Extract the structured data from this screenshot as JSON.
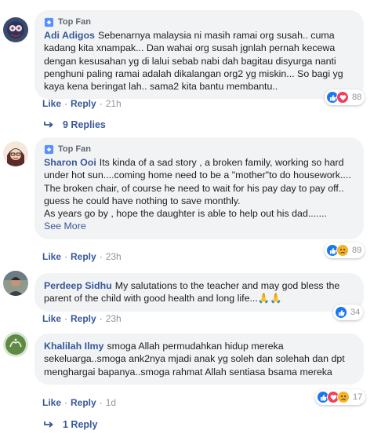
{
  "comments": [
    {
      "badge": "Top Fan",
      "author": "Adi Adigos",
      "text": "Sebenarnya malaysia ni masih ramai org susah.. cuma kadang kita xnampak... Dan wahai org susah jgnlah pernah kecewa dengan kesusahan yg di lalui sebab nabi dah bagitau disyurga nanti penghuni paling ramai adalah dikalangan org2 yg miskin... So bagi yg kaya kena beringat lah.. sama2 kita bantu membantu..",
      "like_label": "Like",
      "reply_label": "Reply",
      "time": "21h",
      "reaction_count": "88",
      "reactions": [
        "like-reaction-icon",
        "love-reaction-icon"
      ],
      "replies_label": "9 Replies"
    },
    {
      "badge": "Top Fan",
      "author": "Sharon Ooi",
      "text": "Its kinda of a sad story , a broken family, working so hard under hot sun....coming home need to be a \"mother\"to do housework....\nThe broken chair, of course he need to wait for his pay day to pay off.. guess he could have nothing to save monthly.\nAs years go by , hope the daughter is able to help out his dad.......",
      "see_more": "See More",
      "like_label": "Like",
      "reply_label": "Reply",
      "time": "23h",
      "reaction_count": "89",
      "reactions": [
        "like-reaction-icon",
        "sad-reaction-icon"
      ]
    },
    {
      "author": "Perdeep Sidhu",
      "text": "My salutations to the teacher and may god bless the parent of the child with good health and long life...🙏🙏",
      "like_label": "Like",
      "reply_label": "Reply",
      "time": "23h",
      "reaction_count": "34",
      "reactions": [
        "like-reaction-icon"
      ]
    },
    {
      "author": "Khalilah Ilmy",
      "text": "smoga Allah permudahkan hidup mereka sekeluarga..smoga ank2nya mjadi anak yg soleh dan solehah dan dpt menghargai bapanya..smoga rahmat Allah sentiasa bsama mereka",
      "like_label": "Like",
      "reply_label": "Reply",
      "time": "1d",
      "reaction_count": "17",
      "reactions": [
        "like-reaction-icon",
        "love-reaction-icon",
        "sad-reaction-icon"
      ],
      "replies_label": "1 Reply"
    }
  ],
  "colors": {
    "link": "#385898",
    "bubble": "#f2f3f5",
    "meta": "#90949c",
    "like": "#1877f2",
    "love": "#f33e58",
    "sad": "#f7b125"
  }
}
